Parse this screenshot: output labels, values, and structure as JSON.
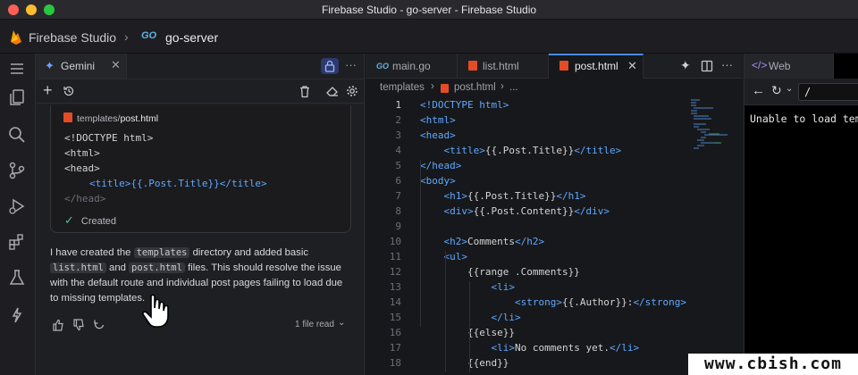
{
  "window": {
    "title": "Firebase Studio - go-server - Firebase Studio"
  },
  "header": {
    "brand": "Firebase Studio",
    "project": "go-server",
    "go_badge": "GO"
  },
  "gemini": {
    "tab_label": "Gemini",
    "file_label_dir": "templates/",
    "file_label_name": "post.html",
    "code_lines": [
      "<!DOCTYPE html>",
      "<html>",
      "<head>",
      "<title>{{.Post.Title}}</title>",
      "</head>"
    ],
    "status": "Created",
    "message_parts": [
      "I have created the ",
      "templates",
      " directory and added basic ",
      "list.html",
      " and ",
      "post.html",
      " files. This should resolve the issue with the default route and individual post pages failing to load due to missing templates."
    ],
    "files_read": "1 file read"
  },
  "editor": {
    "tabs": [
      {
        "label": "main.go"
      },
      {
        "label": "list.html"
      },
      {
        "label": "post.html"
      }
    ],
    "breadcrumb": {
      "folder": "templates",
      "file": "post.html",
      "more": "..."
    },
    "lines": [
      {
        "n": "1",
        "text": "<!DOCTYPE html>"
      },
      {
        "n": "2",
        "text": "<html>"
      },
      {
        "n": "3",
        "text": "<head>"
      },
      {
        "n": "4",
        "text": "    <title>{{.Post.Title}}</title>"
      },
      {
        "n": "5",
        "text": "</head>"
      },
      {
        "n": "6",
        "text": "<body>"
      },
      {
        "n": "7",
        "text": "    <h1>{{.Post.Title}}</h1>"
      },
      {
        "n": "8",
        "text": "    <div>{{.Post.Content}}</div>"
      },
      {
        "n": "9",
        "text": ""
      },
      {
        "n": "10",
        "text": "    <h2>Comments</h2>"
      },
      {
        "n": "11",
        "text": "    <ul>"
      },
      {
        "n": "12",
        "text": "        {{range .Comments}}"
      },
      {
        "n": "13",
        "text": "            <li>"
      },
      {
        "n": "14",
        "text": "                <strong>{{.Author}}:</strong>"
      },
      {
        "n": "15",
        "text": "            </li>"
      },
      {
        "n": "16",
        "text": "        {{else}}"
      },
      {
        "n": "17",
        "text": "            <li>No comments yet.</li>"
      },
      {
        "n": "18",
        "text": "        {{end}}"
      }
    ]
  },
  "web": {
    "tab_label": "Web",
    "url": "/",
    "message": "Unable to load temp"
  },
  "watermark": "www.cbish.com",
  "colors": {
    "accent": "#4a8cff",
    "tag": "#5fa8ff",
    "lock_bg": "#2c3a6e"
  }
}
